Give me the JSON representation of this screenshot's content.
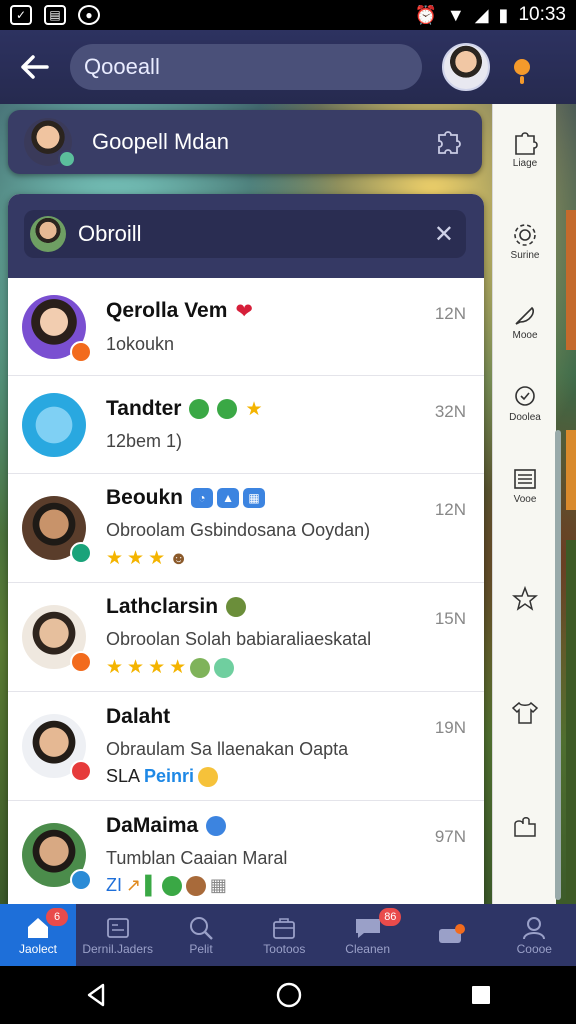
{
  "status_bar": {
    "time": "10:33"
  },
  "header": {
    "search_text": "Qooeall"
  },
  "pinned": {
    "name": "Goopell Mdan"
  },
  "panel": {
    "search_text": "Obroill"
  },
  "chats": [
    {
      "name": "Qerolla Vem",
      "subtitle": "1okoukn",
      "time": "12N",
      "avatar_color": "#7a4fd1",
      "badge_color": "#f26b1d"
    },
    {
      "name": "Tandter",
      "subtitle": "12bem 1)",
      "time": "32N",
      "avatar_color": "#29a8e0",
      "badge_color": ""
    },
    {
      "name": "Beoukn",
      "subtitle": "Obroolam Gsbindosana Ooydan)",
      "time": "12N",
      "avatar_color": "#5a3d2b",
      "badge_color": "#1aa37a"
    },
    {
      "name": "Lathclarsin",
      "subtitle": "Obroolan Solah babiaraliaeskatal",
      "time": "15N",
      "avatar_color": "#c9a27e",
      "badge_color": "#f26b1d"
    },
    {
      "name": "Dalaht",
      "subtitle": "Obraulam Sa llaenakan Oapta",
      "extra_prefix": "SLA",
      "extra_blue": "Peinri",
      "time": "19N",
      "avatar_color": "#d9b08a",
      "badge_color": "#e63b3b"
    },
    {
      "name": "DaMaima",
      "subtitle": "Tumblan Caaian Maral",
      "extra_prefix": "ZI",
      "time": "97N",
      "avatar_color": "#4b8c4b",
      "badge_color": "#2b8bd6"
    }
  ],
  "sidebar": {
    "items": [
      {
        "label": "Liage",
        "icon": "puzzle-icon"
      },
      {
        "label": "Surine",
        "icon": "gear-icon"
      },
      {
        "label": "Mooe",
        "icon": "feather-icon"
      },
      {
        "label": "Doolea",
        "icon": "chat-icon"
      },
      {
        "label": "Vooe",
        "icon": "list-icon"
      },
      {
        "label": "",
        "icon": "star-icon"
      },
      {
        "label": "",
        "icon": "shirt-icon"
      },
      {
        "label": "",
        "icon": "glove-icon"
      }
    ]
  },
  "bottom_nav": [
    {
      "label": "Jaolect",
      "icon": "home-icon",
      "badge": "6",
      "active": true
    },
    {
      "label": "Dernil.Jaders",
      "icon": "card-icon",
      "badge": ""
    },
    {
      "label": "Pelit",
      "icon": "search-icon",
      "badge": ""
    },
    {
      "label": "Tootoos",
      "icon": "box-icon",
      "badge": ""
    },
    {
      "label": "Cleanen",
      "icon": "chat-icon",
      "badge": "86"
    },
    {
      "label": "",
      "icon": "game-icon",
      "badge": ""
    },
    {
      "label": "Coooe",
      "icon": "person-icon",
      "badge": ""
    }
  ]
}
